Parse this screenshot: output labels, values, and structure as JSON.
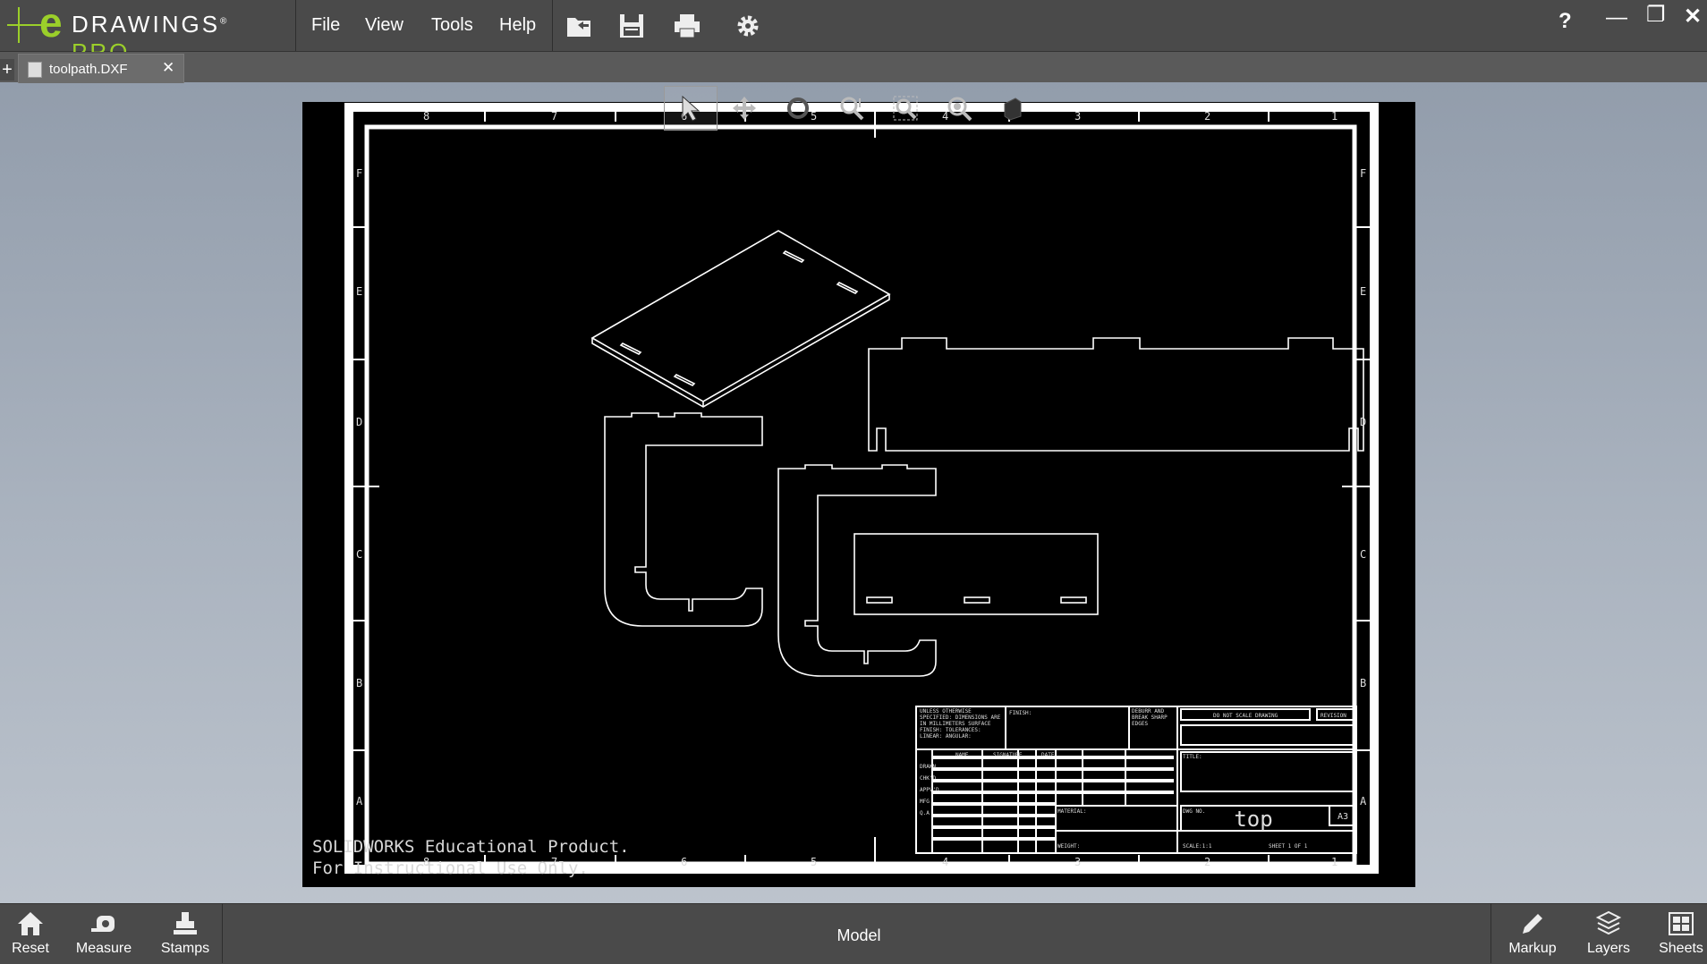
{
  "app": {
    "logo_e": "e",
    "logo_word": "DRAWINGS",
    "logo_reg": "®",
    "logo_pro": "PRO"
  },
  "menu": {
    "file": "File",
    "view": "View",
    "tools": "Tools",
    "help": "Help"
  },
  "toolbar_icons": [
    "open-file-icon",
    "save-icon",
    "print-icon",
    "settings-gear-icon"
  ],
  "window_controls": {
    "help": "?",
    "minimize": "—",
    "restore": "❐",
    "close": "✕"
  },
  "tab": {
    "new_tab": "+",
    "filename": "toolpath.DXF",
    "close": "✕"
  },
  "view_tools": [
    "select-arrow-icon",
    "pan-icon",
    "rotate-icon",
    "zoom-area-icon",
    "zoom-fit-icon",
    "zoom-icon",
    "display-style-icon"
  ],
  "drawing": {
    "watermark_line1": "SOLIDWORKS Educational Product.",
    "watermark_line2": "For Instructional Use Only.",
    "zone_numbers": [
      "8",
      "7",
      "6",
      "5",
      "4",
      "3",
      "2",
      "1"
    ],
    "zone_letters": [
      "F",
      "E",
      "D",
      "C",
      "B",
      "A"
    ],
    "title_block": {
      "unless_note": "UNLESS OTHERWISE SPECIFIED: DIMENSIONS ARE IN MILLIMETERS SURFACE FINISH: TOLERANCES: LINEAR: ANGULAR:",
      "finish": "FINISH:",
      "deburr": "DEBURR AND BREAK SHARP EDGES",
      "do_not_scale": "DO NOT SCALE DRAWING",
      "revision": "REVISION",
      "title_label": "TITLE:",
      "material": "MATERIAL:",
      "dwg_no": "DWG NO.",
      "drawing_title": "top",
      "size": "A3",
      "weight": "WEIGHT:",
      "scale": "SCALE:1:1",
      "sheet": "SHEET 1 OF 1",
      "headers": [
        "NAME",
        "SIGNATURE",
        "DATE"
      ],
      "rows": [
        "DRAWN",
        "CHK'D",
        "APPV'D",
        "MFG",
        "Q.A"
      ]
    }
  },
  "bottom": {
    "reset": "Reset",
    "measure": "Measure",
    "stamps": "Stamps",
    "mode": "Model",
    "markup": "Markup",
    "layers": "Layers",
    "sheets": "Sheets"
  },
  "colors": {
    "accent": "#9bcf2a",
    "chrome": "#4a4a4a",
    "canvas": "#000000",
    "lines": "#ffffff"
  }
}
